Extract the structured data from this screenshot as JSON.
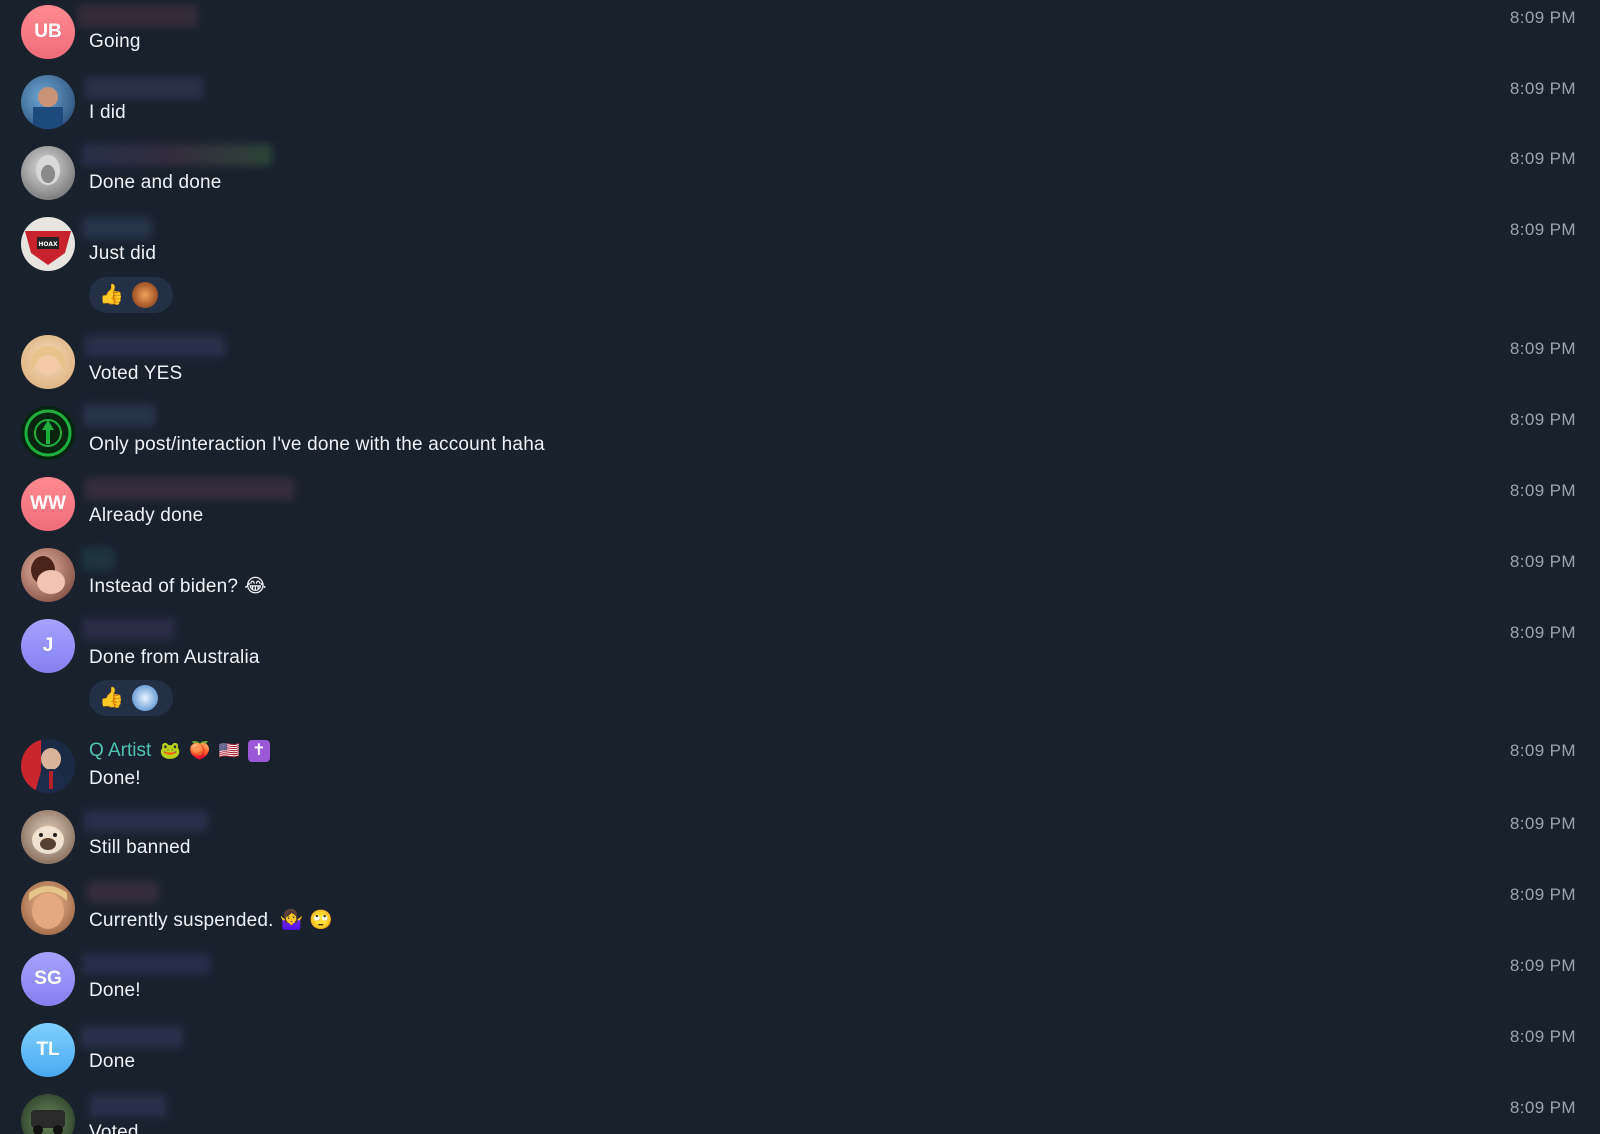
{
  "messages": [
    {
      "avatar_initials": "UB",
      "avatar_color": "#f47e86",
      "name_blurred": true,
      "text": "Going",
      "time": "8:09 PM"
    },
    {
      "avatar_initials": "",
      "avatar_color": "#2f6e9e",
      "avatar_icon": "photo-avatar-icon",
      "name_blurred": true,
      "text": "I did",
      "time": "8:09 PM"
    },
    {
      "avatar_initials": "",
      "avatar_color": "#bfbfbf",
      "avatar_icon": "photo-avatar-icon",
      "name_blurred": true,
      "text": "Done and done",
      "time": "8:09 PM"
    },
    {
      "avatar_initials": "",
      "avatar_color": "#c8232d",
      "avatar_icon": "hoax-mask-avatar-icon",
      "name_blurred": true,
      "text": "Just did",
      "time": "8:09 PM",
      "reactions": [
        "👍"
      ]
    },
    {
      "avatar_initials": "",
      "avatar_color": "#e8c99b",
      "avatar_icon": "photo-avatar-icon",
      "name_blurred": true,
      "text": "Voted YES",
      "time": "8:09 PM"
    },
    {
      "avatar_initials": "",
      "avatar_color": "#0b3b16",
      "avatar_icon": "green-seal-avatar-icon",
      "name_blurred": true,
      "text": "Only post/interaction I've done with the account haha",
      "time": "8:09 PM"
    },
    {
      "avatar_initials": "WW",
      "avatar_color": "#f47e86",
      "name_blurred": true,
      "text": "Already done",
      "time": "8:09 PM"
    },
    {
      "avatar_initials": "",
      "avatar_color": "#c98b7c",
      "avatar_icon": "photo-avatar-icon",
      "name_blurred": true,
      "text": "Instead of biden?",
      "emoji": "😂",
      "time": "8:09 PM"
    },
    {
      "avatar_initials": "J",
      "avatar_color": "#8e8af5",
      "name_blurred": true,
      "text": "Done from Australia",
      "time": "8:09 PM",
      "reactions": [
        "👍"
      ]
    },
    {
      "avatar_initials": "",
      "avatar_color": "#b53030",
      "avatar_icon": "portrait-avatar-icon",
      "name_blurred": false,
      "sender_name": "Q Artist",
      "sender_badges": [
        "🐸",
        "🍑",
        "🇺🇸",
        "✝"
      ],
      "text": "Done!",
      "time": "8:09 PM"
    },
    {
      "avatar_initials": "",
      "avatar_color": "#a88c6c",
      "avatar_icon": "bulldog-avatar-icon",
      "name_blurred": true,
      "text": "Still banned",
      "time": "8:09 PM"
    },
    {
      "avatar_initials": "",
      "avatar_color": "#c78b6b",
      "avatar_icon": "photo-avatar-icon",
      "name_blurred": true,
      "text": "Currently suspended.",
      "emoji": "🤷‍♀️ 🙄",
      "time": "8:09 PM"
    },
    {
      "avatar_initials": "SG",
      "avatar_color": "#8e8af5",
      "name_blurred": true,
      "text": "Done!",
      "time": "8:09 PM"
    },
    {
      "avatar_initials": "TL",
      "avatar_color": "#5fb8f0",
      "name_blurred": true,
      "text": "Done",
      "time": "8:09 PM"
    },
    {
      "avatar_initials": "",
      "avatar_color": "#3e5a3a",
      "avatar_icon": "photo-avatar-icon",
      "name_blurred": true,
      "text": "Voted",
      "time": "8:09 PM"
    }
  ]
}
